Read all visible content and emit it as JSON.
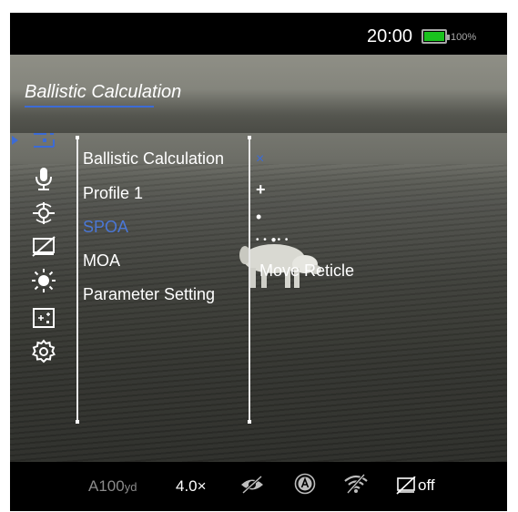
{
  "status": {
    "time": "20:00",
    "battery_pct": "100%",
    "battery_level": 1.0,
    "battery_color": "#1ac21e"
  },
  "title": "Ballistic Calculation",
  "accent_color": "#3c6bd6",
  "sidebar": {
    "icons": [
      {
        "name": "reticle-icon",
        "selected": true
      },
      {
        "name": "microphone-icon"
      },
      {
        "name": "calibration-icon"
      },
      {
        "name": "display-off-icon"
      },
      {
        "name": "brightness-icon"
      },
      {
        "name": "reticle-plus-icon"
      },
      {
        "name": "settings-gear-icon"
      }
    ]
  },
  "menu": {
    "items": [
      {
        "label": "Ballistic Calculation"
      },
      {
        "label": "Profile 1"
      },
      {
        "label": "SPOA",
        "active": true
      },
      {
        "label": "MOA"
      },
      {
        "label": "Parameter Setting"
      }
    ]
  },
  "reticle_options": {
    "x_mark": "×",
    "plus_mark": "+",
    "dot_mark": "•",
    "dots_mark": "• • ●• •",
    "move_label": "Move Reticle"
  },
  "bottom": {
    "range_value": "A100",
    "range_unit": "yd",
    "zoom": "4.0×",
    "display_off_label": "off"
  }
}
